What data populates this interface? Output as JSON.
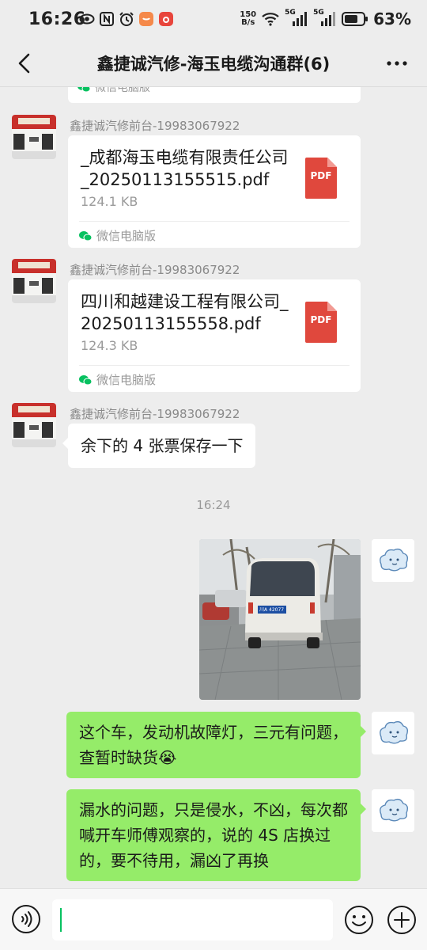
{
  "status_bar": {
    "time": "16:26",
    "net_speed_value": "150",
    "net_speed_unit": "B/s",
    "signal1_label": "5G",
    "signal2_label": "5G",
    "battery_pct": "63%"
  },
  "header": {
    "title": "鑫捷诚汽修-海玉电缆沟通群(6)"
  },
  "messages": {
    "top_card_source": "微信电脑版",
    "msg1": {
      "sender": "鑫捷诚汽修前台-19983067922",
      "file_name": "_成都海玉电缆有限责任公司_20250113155515.pdf",
      "file_size": "124.1 KB",
      "file_badge": "PDF",
      "source": "微信电脑版"
    },
    "msg2": {
      "sender": "鑫捷诚汽修前台-19983067922",
      "file_name": "四川和越建设工程有限公司_20250113155558.pdf",
      "file_size": "124.3 KB",
      "file_badge": "PDF",
      "source": "微信电脑版"
    },
    "msg3": {
      "sender": "鑫捷诚汽修前台-19983067922",
      "text": "余下的 4 张票保存一下"
    },
    "time_separator": "16:24",
    "msg5_text": "这个车，发动机故障灯，三元有问题，查暂时缺货😭",
    "msg6_text": "漏水的问题，只是侵水，不凶，每次都喊开车师傅观察的，说的 4S 店换过的，要不待用，漏凶了再换"
  },
  "photo": {
    "plate_text": "川A 42077"
  },
  "colors": {
    "background": "#ededed",
    "my_bubble": "#95ec69",
    "their_bubble": "#ffffff",
    "pdf_red": "#e0483d",
    "wechat_green": "#07c160"
  },
  "icons": {
    "back": "chevron-left-icon",
    "more": "more-dots-icon",
    "voice": "voice-icon",
    "emoji": "emoji-icon",
    "plus": "plus-icon",
    "pdf": "pdf-file-icon"
  }
}
